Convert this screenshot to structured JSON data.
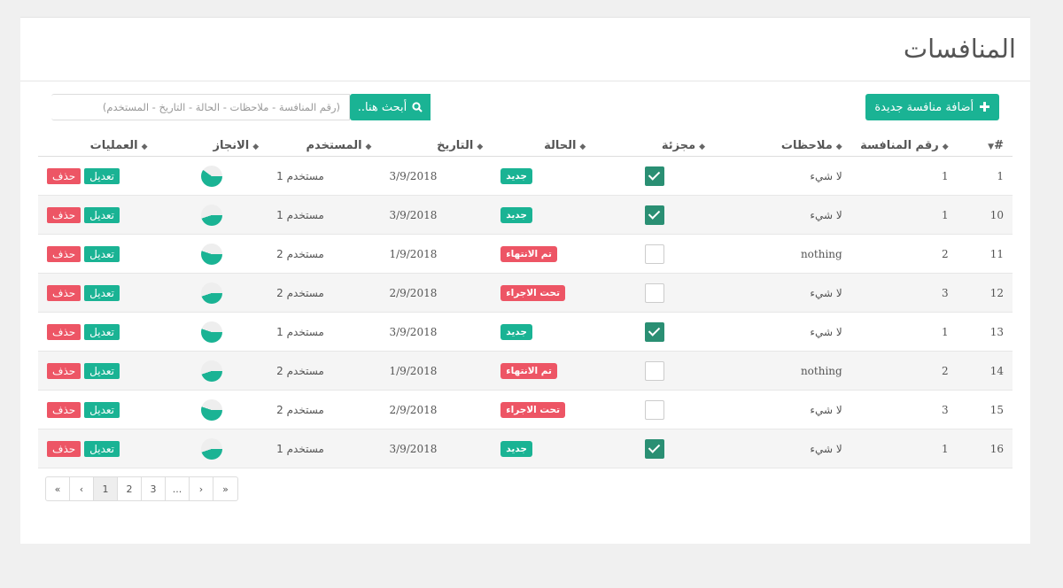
{
  "page": {
    "title": "المنافسات"
  },
  "toolbar": {
    "add_label": "أضافة منافسة جديدة",
    "search_button": "أبحث هنا..",
    "search_placeholder": "(رقم المنافسة - ملاحظات - الحالة - التاريخ - المستخدم)"
  },
  "colors": {
    "accent": "#1ab394",
    "danger": "#ed5565",
    "checked": "#2a8f73",
    "progress": "#1ab394"
  },
  "table": {
    "headers": [
      "#",
      "رقم المنافسة",
      "ملاحظات",
      "مجزئة",
      "الحالة",
      "التاريخ",
      "المستخدم",
      "الانجاز",
      "العمليات"
    ],
    "edit_label": "تعديل",
    "delete_label": "حذف",
    "rows": [
      {
        "id": "1",
        "num": "1",
        "notes": "لا شيء",
        "split": true,
        "status": "جديد",
        "status_color": "#1ab394",
        "date": "3/9/2018",
        "user": "مستخدم 1",
        "progress": 0.6
      },
      {
        "id": "10",
        "num": "1",
        "notes": "لا شيء",
        "split": true,
        "status": "جديد",
        "status_color": "#1ab394",
        "date": "3/9/2018",
        "user": "مستخدم 1",
        "progress": 0.45
      },
      {
        "id": "11",
        "num": "2",
        "notes": "nothing",
        "split": false,
        "status": "تم الانتهاء",
        "status_color": "#ed5565",
        "date": "1/9/2018",
        "user": "مستخدم 2",
        "progress": 0.55
      },
      {
        "id": "12",
        "num": "3",
        "notes": "لا شيء",
        "split": false,
        "status": "تحت الاجراء",
        "status_color": "#ed5565",
        "date": "2/9/2018",
        "user": "مستخدم 2",
        "progress": 0.45
      },
      {
        "id": "13",
        "num": "1",
        "notes": "لا شيء",
        "split": true,
        "status": "جديد",
        "status_color": "#1ab394",
        "date": "3/9/2018",
        "user": "مستخدم 1",
        "progress": 0.55
      },
      {
        "id": "14",
        "num": "2",
        "notes": "nothing",
        "split": false,
        "status": "تم الانتهاء",
        "status_color": "#ed5565",
        "date": "1/9/2018",
        "user": "مستخدم 2",
        "progress": 0.45
      },
      {
        "id": "15",
        "num": "3",
        "notes": "لا شيء",
        "split": false,
        "status": "تحت الاجراء",
        "status_color": "#ed5565",
        "date": "2/9/2018",
        "user": "مستخدم 2",
        "progress": 0.55
      },
      {
        "id": "16",
        "num": "1",
        "notes": "لا شيء",
        "split": true,
        "status": "جديد",
        "status_color": "#1ab394",
        "date": "3/9/2018",
        "user": "مستخدم 1",
        "progress": 0.45
      }
    ]
  },
  "pagination": {
    "items": [
      "«",
      "‹",
      "1",
      "2",
      "3",
      "...",
      "›",
      "»"
    ],
    "active": "1"
  }
}
